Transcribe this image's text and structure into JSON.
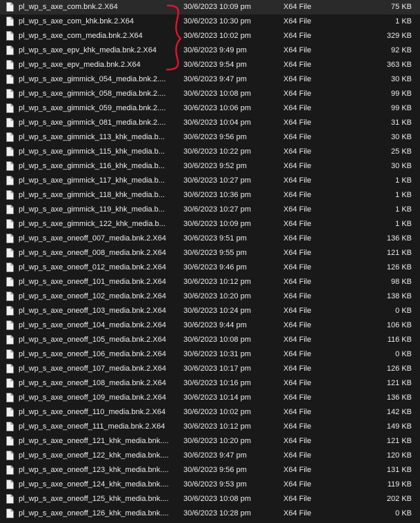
{
  "files": [
    {
      "name": "pl_wp_s_axe_com.bnk.2.X64",
      "date": "30/6/2023 10:09 pm",
      "type": "X64 File",
      "size": "75 KB"
    },
    {
      "name": "pl_wp_s_axe_com_khk.bnk.2.X64",
      "date": "30/6/2023 10:30 pm",
      "type": "X64 File",
      "size": "1 KB"
    },
    {
      "name": "pl_wp_s_axe_com_media.bnk.2.X64",
      "date": "30/6/2023 10:02 pm",
      "type": "X64 File",
      "size": "329 KB"
    },
    {
      "name": "pl_wp_s_axe_epv_khk_media.bnk.2.X64",
      "date": "30/6/2023 9:49 pm",
      "type": "X64 File",
      "size": "92 KB"
    },
    {
      "name": "pl_wp_s_axe_epv_media.bnk.2.X64",
      "date": "30/6/2023 9:54 pm",
      "type": "X64 File",
      "size": "363 KB"
    },
    {
      "name": "pl_wp_s_axe_gimmick_054_media.bnk.2....",
      "date": "30/6/2023 9:47 pm",
      "type": "X64 File",
      "size": "30 KB"
    },
    {
      "name": "pl_wp_s_axe_gimmick_058_media.bnk.2....",
      "date": "30/6/2023 10:08 pm",
      "type": "X64 File",
      "size": "99 KB"
    },
    {
      "name": "pl_wp_s_axe_gimmick_059_media.bnk.2....",
      "date": "30/6/2023 10:06 pm",
      "type": "X64 File",
      "size": "99 KB"
    },
    {
      "name": "pl_wp_s_axe_gimmick_081_media.bnk.2....",
      "date": "30/6/2023 10:04 pm",
      "type": "X64 File",
      "size": "31 KB"
    },
    {
      "name": "pl_wp_s_axe_gimmick_113_khk_media.b...",
      "date": "30/6/2023 9:56 pm",
      "type": "X64 File",
      "size": "30 KB"
    },
    {
      "name": "pl_wp_s_axe_gimmick_115_khk_media.b...",
      "date": "30/6/2023 10:22 pm",
      "type": "X64 File",
      "size": "25 KB"
    },
    {
      "name": "pl_wp_s_axe_gimmick_116_khk_media.b...",
      "date": "30/6/2023 9:52 pm",
      "type": "X64 File",
      "size": "30 KB"
    },
    {
      "name": "pl_wp_s_axe_gimmick_117_khk_media.b...",
      "date": "30/6/2023 10:27 pm",
      "type": "X64 File",
      "size": "1 KB"
    },
    {
      "name": "pl_wp_s_axe_gimmick_118_khk_media.b...",
      "date": "30/6/2023 10:36 pm",
      "type": "X64 File",
      "size": "1 KB"
    },
    {
      "name": "pl_wp_s_axe_gimmick_119_khk_media.b...",
      "date": "30/6/2023 10:27 pm",
      "type": "X64 File",
      "size": "1 KB"
    },
    {
      "name": "pl_wp_s_axe_gimmick_122_khk_media.b...",
      "date": "30/6/2023 10:09 pm",
      "type": "X64 File",
      "size": "1 KB"
    },
    {
      "name": "pl_wp_s_axe_oneoff_007_media.bnk.2.X64",
      "date": "30/6/2023 9:51 pm",
      "type": "X64 File",
      "size": "136 KB"
    },
    {
      "name": "pl_wp_s_axe_oneoff_008_media.bnk.2.X64",
      "date": "30/6/2023 9:55 pm",
      "type": "X64 File",
      "size": "121 KB"
    },
    {
      "name": "pl_wp_s_axe_oneoff_012_media.bnk.2.X64",
      "date": "30/6/2023 9:46 pm",
      "type": "X64 File",
      "size": "126 KB"
    },
    {
      "name": "pl_wp_s_axe_oneoff_101_media.bnk.2.X64",
      "date": "30/6/2023 10:12 pm",
      "type": "X64 File",
      "size": "98 KB"
    },
    {
      "name": "pl_wp_s_axe_oneoff_102_media.bnk.2.X64",
      "date": "30/6/2023 10:20 pm",
      "type": "X64 File",
      "size": "138 KB"
    },
    {
      "name": "pl_wp_s_axe_oneoff_103_media.bnk.2.X64",
      "date": "30/6/2023 10:24 pm",
      "type": "X64 File",
      "size": "0 KB"
    },
    {
      "name": "pl_wp_s_axe_oneoff_104_media.bnk.2.X64",
      "date": "30/6/2023 9:44 pm",
      "type": "X64 File",
      "size": "106 KB"
    },
    {
      "name": "pl_wp_s_axe_oneoff_105_media.bnk.2.X64",
      "date": "30/6/2023 10:08 pm",
      "type": "X64 File",
      "size": "116 KB"
    },
    {
      "name": "pl_wp_s_axe_oneoff_106_media.bnk.2.X64",
      "date": "30/6/2023 10:31 pm",
      "type": "X64 File",
      "size": "0 KB"
    },
    {
      "name": "pl_wp_s_axe_oneoff_107_media.bnk.2.X64",
      "date": "30/6/2023 10:17 pm",
      "type": "X64 File",
      "size": "126 KB"
    },
    {
      "name": "pl_wp_s_axe_oneoff_108_media.bnk.2.X64",
      "date": "30/6/2023 10:16 pm",
      "type": "X64 File",
      "size": "121 KB"
    },
    {
      "name": "pl_wp_s_axe_oneoff_109_media.bnk.2.X64",
      "date": "30/6/2023 10:14 pm",
      "type": "X64 File",
      "size": "136 KB"
    },
    {
      "name": "pl_wp_s_axe_oneoff_110_media.bnk.2.X64",
      "date": "30/6/2023 10:02 pm",
      "type": "X64 File",
      "size": "142 KB"
    },
    {
      "name": "pl_wp_s_axe_oneoff_111_media.bnk.2.X64",
      "date": "30/6/2023 10:12 pm",
      "type": "X64 File",
      "size": "149 KB"
    },
    {
      "name": "pl_wp_s_axe_oneoff_121_khk_media.bnk....",
      "date": "30/6/2023 10:20 pm",
      "type": "X64 File",
      "size": "121 KB"
    },
    {
      "name": "pl_wp_s_axe_oneoff_122_khk_media.bnk....",
      "date": "30/6/2023 9:47 pm",
      "type": "X64 File",
      "size": "120 KB"
    },
    {
      "name": "pl_wp_s_axe_oneoff_123_khk_media.bnk....",
      "date": "30/6/2023 9:56 pm",
      "type": "X64 File",
      "size": "131 KB"
    },
    {
      "name": "pl_wp_s_axe_oneoff_124_khk_media.bnk....",
      "date": "30/6/2023 9:53 pm",
      "type": "X64 File",
      "size": "119 KB"
    },
    {
      "name": "pl_wp_s_axe_oneoff_125_khk_media.bnk....",
      "date": "30/6/2023 10:08 pm",
      "type": "X64 File",
      "size": "202 KB"
    },
    {
      "name": "pl_wp_s_axe_oneoff_126_khk_media.bnk....",
      "date": "30/6/2023 10:28 pm",
      "type": "X64 File",
      "size": "0 KB"
    }
  ],
  "file_icon_name": "file-icon",
  "annotation": {
    "shape": "bracket",
    "color": "#e8102a",
    "spans_files": [
      0,
      4
    ]
  },
  "colors": {
    "background": "#191919",
    "text": "#ececec",
    "icon_fill": "#f2f2f2",
    "icon_fold": "#bdbdbd"
  }
}
